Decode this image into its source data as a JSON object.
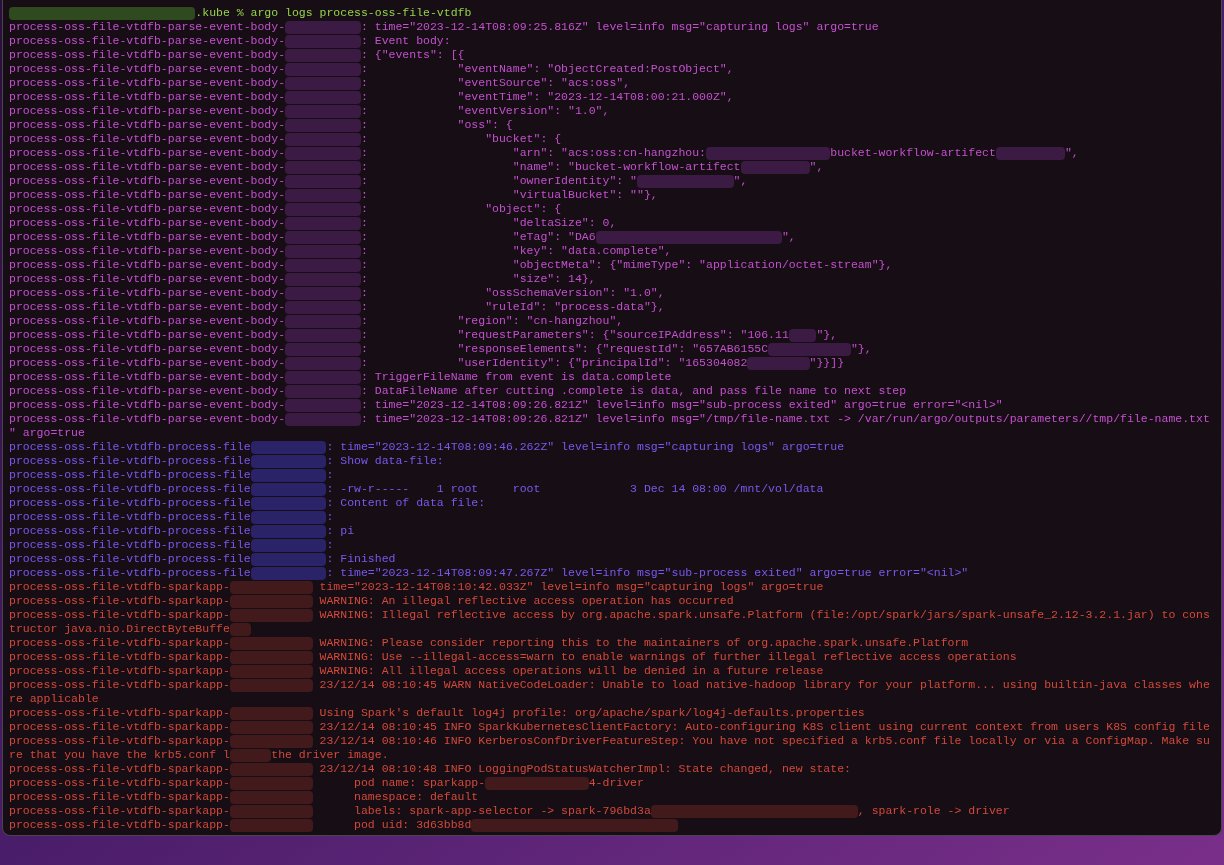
{
  "terminal": {
    "prompt": ".kube % argo logs process-oss-file-vtdfb",
    "groups": [
      {
        "color": "#c451ce",
        "separator": ":",
        "lines": [
          {
            "pod": "process-oss-file-vtdfb-parse-event-body-",
            "parts": [
              "time=\"2023-12-14T08:09:25.816Z\" level=info msg=\"capturing logs\" argo=true"
            ]
          },
          {
            "pod": "process-oss-file-vtdfb-parse-event-body-",
            "parts": [
              "Event body:"
            ]
          },
          {
            "pod": "process-oss-file-vtdfb-parse-event-body-",
            "parts": [
              "{\"events\": [{"
            ]
          },
          {
            "pod": "process-oss-file-vtdfb-parse-event-body-",
            "parts": [
              "            \"eventName\": \"ObjectCreated:PostObject\","
            ]
          },
          {
            "pod": "process-oss-file-vtdfb-parse-event-body-",
            "parts": [
              "            \"eventSource\": \"acs:oss\","
            ]
          },
          {
            "pod": "process-oss-file-vtdfb-parse-event-body-",
            "parts": [
              "            \"eventTime\": \"2023-12-14T08:00:21.000Z\","
            ]
          },
          {
            "pod": "process-oss-file-vtdfb-parse-event-body-",
            "parts": [
              "            \"eventVersion\": \"1.0\","
            ]
          },
          {
            "pod": "process-oss-file-vtdfb-parse-event-body-",
            "parts": [
              "            \"oss\": {"
            ]
          },
          {
            "pod": "process-oss-file-vtdfb-parse-event-body-",
            "parts": [
              "                \"bucket\": {"
            ]
          },
          {
            "pod": "process-oss-file-vtdfb-parse-event-body-",
            "parts": [
              "                    \"arn\": \"acs:oss:cn-hangzhou:",
              "bucket-workflow-artifect",
              "\","
            ]
          },
          {
            "pod": "process-oss-file-vtdfb-parse-event-body-",
            "parts": [
              "                    \"name\": \"bucket-workflow-artifect",
              "\","
            ]
          },
          {
            "pod": "process-oss-file-vtdfb-parse-event-body-",
            "parts": [
              "                    \"ownerIdentity\": \"",
              "\","
            ]
          },
          {
            "pod": "process-oss-file-vtdfb-parse-event-body-",
            "parts": [
              "                    \"virtualBucket\": \"\"},"
            ]
          },
          {
            "pod": "process-oss-file-vtdfb-parse-event-body-",
            "parts": [
              "                \"object\": {"
            ]
          },
          {
            "pod": "process-oss-file-vtdfb-parse-event-body-",
            "parts": [
              "                    \"deltaSize\": 0,"
            ]
          },
          {
            "pod": "process-oss-file-vtdfb-parse-event-body-",
            "parts": [
              "                    \"eTag\": \"DA6",
              "\","
            ]
          },
          {
            "pod": "process-oss-file-vtdfb-parse-event-body-",
            "parts": [
              "                    \"key\": \"data.complete\","
            ]
          },
          {
            "pod": "process-oss-file-vtdfb-parse-event-body-",
            "parts": [
              "                    \"objectMeta\": {\"mimeType\": \"application/octet-stream\"},"
            ]
          },
          {
            "pod": "process-oss-file-vtdfb-parse-event-body-",
            "parts": [
              "                    \"size\": 14},"
            ]
          },
          {
            "pod": "process-oss-file-vtdfb-parse-event-body-",
            "parts": [
              "                \"ossSchemaVersion\": \"1.0\","
            ]
          },
          {
            "pod": "process-oss-file-vtdfb-parse-event-body-",
            "parts": [
              "                \"ruleId\": \"process-data\"},"
            ]
          },
          {
            "pod": "process-oss-file-vtdfb-parse-event-body-",
            "parts": [
              "            \"region\": \"cn-hangzhou\","
            ]
          },
          {
            "pod": "process-oss-file-vtdfb-parse-event-body-",
            "parts": [
              "            \"requestParameters\": {\"sourceIPAddress\": \"106.11",
              "\"},"
            ]
          },
          {
            "pod": "process-oss-file-vtdfb-parse-event-body-",
            "parts": [
              "            \"responseElements\": {\"requestId\": \"657AB6155C",
              "\"},"
            ]
          },
          {
            "pod": "process-oss-file-vtdfb-parse-event-body-",
            "parts": [
              "            \"userIdentity\": {\"principalId\": \"165304082",
              "\"}}]}"
            ]
          },
          {
            "pod": "process-oss-file-vtdfb-parse-event-body-",
            "parts": [
              "TriggerFileName from event is data.complete"
            ]
          },
          {
            "pod": "process-oss-file-vtdfb-parse-event-body-",
            "parts": [
              "DataFileName after cutting .complete is data, and pass file name to next step"
            ]
          },
          {
            "pod": "process-oss-file-vtdfb-parse-event-body-",
            "parts": [
              "time=\"2023-12-14T08:09:26.821Z\" level=info msg=\"sub-process exited\" argo=true error=\"<nil>\""
            ]
          },
          {
            "pod": "process-oss-file-vtdfb-parse-event-body-",
            "parts": [
              "time=\"2023-12-14T08:09:26.821Z\" level=info msg=\"/tmp/file-name.txt -> /var/run/argo/outputs/parameters//tmp/file-name.txt"
            ]
          },
          {
            "kind": "wrap",
            "parts": [
              "\" argo=true"
            ]
          }
        ]
      },
      {
        "color": "#7b58ec",
        "separator": ":",
        "lines": [
          {
            "pod": "process-oss-file-vtdfb-process-file",
            "parts": [
              "time=\"2023-12-14T08:09:46.262Z\" level=info msg=\"capturing logs\" argo=true"
            ]
          },
          {
            "pod": "process-oss-file-vtdfb-process-file",
            "parts": [
              "Show data-file:"
            ]
          },
          {
            "pod": "process-oss-file-vtdfb-process-file"
          },
          {
            "pod": "process-oss-file-vtdfb-process-file",
            "parts": [
              "-rw-r-----    1 root     root             3 Dec 14 08:00 /mnt/vol/data"
            ]
          },
          {
            "pod": "process-oss-file-vtdfb-process-file",
            "parts": [
              "Content of data file:"
            ]
          },
          {
            "pod": "process-oss-file-vtdfb-process-file"
          },
          {
            "pod": "process-oss-file-vtdfb-process-file",
            "parts": [
              "pi"
            ]
          },
          {
            "pod": "process-oss-file-vtdfb-process-file"
          },
          {
            "pod": "process-oss-file-vtdfb-process-file",
            "parts": [
              "Finished"
            ]
          },
          {
            "pod": "process-oss-file-vtdfb-process-file",
            "parts": [
              "time=\"2023-12-14T08:09:47.267Z\" level=info msg=\"sub-process exited\" argo=true error=\"<nil>\""
            ]
          }
        ]
      },
      {
        "color": "#d24a3a",
        "lines": [
          {
            "pod": "process-oss-file-vtdfb-sparkapp-",
            "parts": [
              "time=\"2023-12-14T08:10:42.033Z\" level=info msg=\"capturing logs\" argo=true"
            ]
          },
          {
            "pod": "process-oss-file-vtdfb-sparkapp-",
            "parts": [
              "WARNING: An illegal reflective access operation has occurred"
            ]
          },
          {
            "pod": "process-oss-file-vtdfb-sparkapp-",
            "parts": [
              "WARNING: Illegal reflective access by org.apache.spark.unsafe.Platform (file:/opt/spark/jars/spark-unsafe_2.12-3.2.1.jar) to cons"
            ]
          },
          {
            "kind": "wrap",
            "redacted_end": true,
            "parts": [
              "tructor java.nio.DirectByteBuffe"
            ]
          },
          {
            "pod": "process-oss-file-vtdfb-sparkapp-",
            "parts": [
              "WARNING: Please consider reporting this to the maintainers of org.apache.spark.unsafe.Platform"
            ]
          },
          {
            "pod": "process-oss-file-vtdfb-sparkapp-",
            "parts": [
              "WARNING: Use --illegal-access=warn to enable warnings of further illegal reflective access operations"
            ]
          },
          {
            "pod": "process-oss-file-vtdfb-sparkapp-",
            "parts": [
              "WARNING: All illegal access operations will be denied in a future release"
            ]
          },
          {
            "pod": "process-oss-file-vtdfb-sparkapp-",
            "parts": [
              "23/12/14 08:10:45 WARN NativeCodeLoader: Unable to load native-hadoop library for your platform... using builtin-java classes whe"
            ]
          },
          {
            "kind": "wrap",
            "parts": [
              "re applicable"
            ]
          },
          {
            "pod": "process-oss-file-vtdfb-sparkapp-",
            "parts": [
              "Using Spark's default log4j profile: org/apache/spark/log4j-defaults.properties"
            ]
          },
          {
            "pod": "process-oss-file-vtdfb-sparkapp-",
            "parts": [
              "23/12/14 08:10:45 INFO SparkKubernetesClientFactory: Auto-configuring K8S client using current context from users K8S config file"
            ]
          },
          {
            "pod": "process-oss-file-vtdfb-sparkapp-",
            "parts": [
              "23/12/14 08:10:46 INFO KerberosConfDriverFeatureStep: You have not specified a krb5.conf file locally or via a ConfigMap. Make su"
            ]
          },
          {
            "kind": "wrap",
            "parts": [
              "re that you have the krb5.conf l",
              "the driver image."
            ]
          },
          {
            "pod": "process-oss-file-vtdfb-sparkapp-",
            "parts": [
              "23/12/14 08:10:48 INFO LoggingPodStatusWatcherImpl: State changed, new state:"
            ]
          },
          {
            "pod": "process-oss-file-vtdfb-sparkapp-",
            "parts": [
              "     pod name: sparkapp-",
              "4-driver"
            ]
          },
          {
            "pod": "process-oss-file-vtdfb-sparkapp-",
            "parts": [
              "     namespace: default"
            ]
          },
          {
            "pod": "process-oss-file-vtdfb-sparkapp-",
            "parts": [
              "     labels: spark-app-selector -> spark-796bd3a",
              ", spark-role -> driver"
            ]
          },
          {
            "pod": "process-oss-file-vtdfb-sparkapp-",
            "redacted_end": true,
            "parts": [
              "     pod uid: 3d63bb8d"
            ]
          }
        ]
      }
    ]
  }
}
